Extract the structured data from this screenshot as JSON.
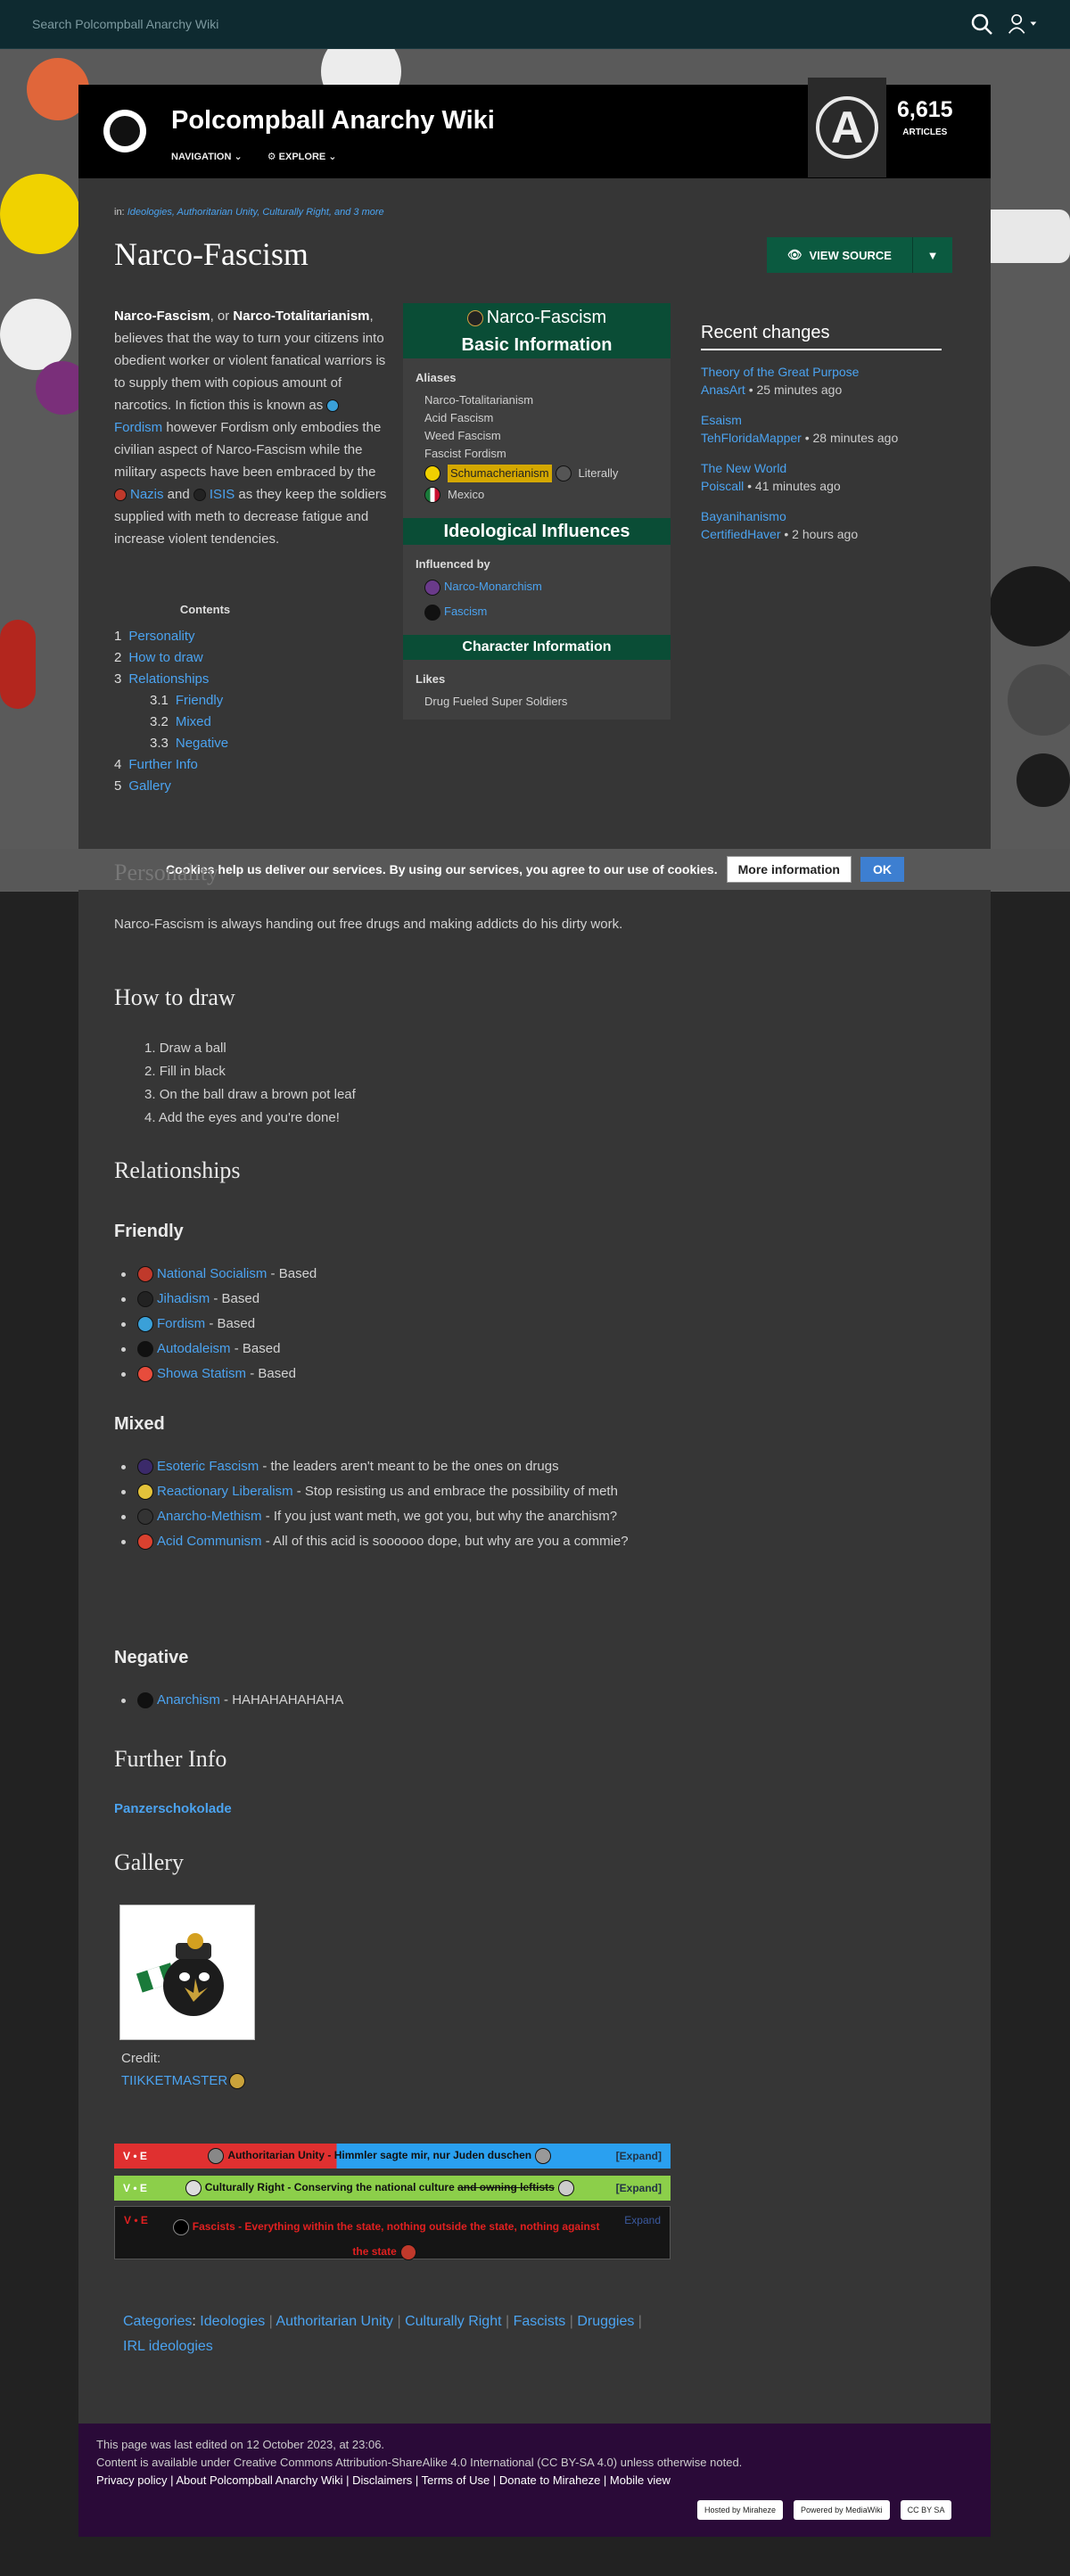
{
  "search": {
    "placeholder": "Search Polcompball Anarchy Wiki"
  },
  "header": {
    "title": "Polcompball Anarchy Wiki",
    "nav1": "NAVIGATION",
    "nav2": "EXPLORE",
    "count": "6,615",
    "count_label": "ARTICLES"
  },
  "page": {
    "categories_prefix": "in:",
    "categories": "Ideologies, Authoritarian Unity, Culturally Right, and 3 more",
    "title": "Narco-Fascism",
    "view_source": "VIEW SOURCE",
    "intro": [
      {
        "t": "Narco-Fascism",
        "b": true
      },
      {
        "t": ", or "
      },
      {
        "t": "Narco-Totalitarianism",
        "b": true
      },
      {
        "t": ", believes that the way to turn your citizens into obedient worker or violent fanatical warriors is to supply them with copious amount of narcotics. In fiction this is known as "
      },
      {
        "t": "Fordism",
        "a": true
      },
      {
        "t": " however Fordism only embodies the civilian aspect of Narco-Fascism while the military aspects have been embraced by the "
      },
      {
        "t": "Nazis",
        "a": true
      },
      {
        "t": " and "
      },
      {
        "t": "ISIS",
        "a": true
      },
      {
        "t": " as they keep the soldiers supplied with meth to decrease fatigue and increase violent tendencies."
      }
    ]
  },
  "toc": {
    "title": "Contents",
    "items": [
      {
        "n": "1",
        "t": "Personality",
        "sub": false
      },
      {
        "n": "2",
        "t": "How to draw",
        "sub": false
      },
      {
        "n": "3",
        "t": "Relationships",
        "sub": false
      },
      {
        "n": "3.1",
        "t": "Friendly",
        "sub": true
      },
      {
        "n": "3.2",
        "t": "Mixed",
        "sub": true
      },
      {
        "n": "3.3",
        "t": "Negative",
        "sub": true
      },
      {
        "n": "4",
        "t": "Further Info",
        "sub": false
      },
      {
        "n": "5",
        "t": "Gallery",
        "sub": false
      }
    ]
  },
  "infobox": {
    "title": "Narco-Fascism",
    "basic": "Basic Information",
    "aliases_label": "Aliases",
    "aliases": [
      "Narco-Totalitarianism",
      "Acid Fascism",
      "Weed Fascism",
      "Fascist Fordism"
    ],
    "alias_schumacher": "Schumacherianism",
    "alias_literally": "Literally",
    "alias_mexico": "Mexico",
    "influences_head": "Ideological Influences",
    "influenced_by_label": "Influenced by",
    "influenced_by": [
      "Narco-Monarchism",
      "Fascism"
    ],
    "character_head": "Character Information",
    "likes_label": "Likes",
    "likes": "Drug Fueled Super Soldiers"
  },
  "recent": {
    "title": "Recent changes",
    "items": [
      {
        "page": "Theory of the Great Purpose",
        "user": "AnasArt",
        "time": " • 25 minutes ago"
      },
      {
        "page": "Esaism",
        "user": "TehFloridaMapper",
        "time": " • 28 minutes ago"
      },
      {
        "page": "The New World",
        "user": "Poiscall",
        "time": " • 41 minutes ago"
      },
      {
        "page": "Bayanihanismo",
        "user": "CertifiedHaver",
        "time": " • 2 hours ago"
      }
    ]
  },
  "cookie": {
    "text": "Cookies help us deliver our services. By using our services, you agree to our use of cookies.",
    "more": "More information",
    "ok": "OK"
  },
  "personality": {
    "heading": "Personality",
    "text": "Narco-Fascism is always handing out free drugs and making addicts do his dirty work."
  },
  "howto": {
    "heading": "How to draw",
    "steps": [
      "Draw a ball",
      "Fill in black",
      "On the ball draw a brown pot leaf",
      "Add the eyes and you're done!"
    ]
  },
  "relationships": {
    "heading": "Relationships",
    "friendly": {
      "heading": "Friendly",
      "items": [
        {
          "name": "National Socialism",
          "note": " - Based",
          "color": "#c0392b"
        },
        {
          "name": "Jihadism",
          "note": " - Based",
          "color": "#222"
        },
        {
          "name": "Fordism",
          "note": " - Based",
          "color": "#3aa0d8"
        },
        {
          "name": "Autodaleism",
          "note": " - Based",
          "color": "#111"
        },
        {
          "name": "Showa Statism",
          "note": " - Based",
          "color": "#e74c3c"
        }
      ]
    },
    "mixed": {
      "heading": "Mixed",
      "items": [
        {
          "name": "Esoteric Fascism",
          "note": " - the leaders aren't meant to be the ones on drugs",
          "color": "#3b2a6a"
        },
        {
          "name": "Reactionary Liberalism",
          "note": " - Stop resisting us and embrace the possibility of meth",
          "color": "#e3c23a"
        },
        {
          "name": "Anarcho-Methism",
          "note": " - If you just want meth, we got you, but why the anarchism?",
          "color": "#333"
        },
        {
          "name": "Acid Communism",
          "note": " - All of this acid is soooooo dope, but why are you a commie?",
          "color": "#d9412f"
        }
      ]
    },
    "negative": {
      "heading": "Negative",
      "items": [
        {
          "name": "Anarchism",
          "note": " - HAHAHAHAHAHA",
          "color": "#111"
        }
      ]
    }
  },
  "further": {
    "heading": "Further Info",
    "link": "Panzerschokolade"
  },
  "gallery": {
    "heading": "Gallery",
    "credit_label": "Credit:",
    "credit_user": "TIIKKETMASTER"
  },
  "navboxes": [
    {
      "vte": "V • E",
      "title": "Authoritarian Unity - Himmler sagte mir, nur Juden duschen",
      "expand": "[Expand]"
    },
    {
      "vte": "V • E",
      "title": "Culturally Right - Conserving the national culture",
      "strike": "and owning leftists",
      "expand": "[Expand]"
    },
    {
      "vte": "V • E",
      "title": "Fascists - Everything within the state, nothing outside the state, nothing against the state",
      "expand": "Expand"
    }
  ],
  "catlinks": {
    "label": "Categories",
    "items": [
      "Ideologies",
      "Authoritarian Unity",
      "Culturally Right",
      "Fascists",
      "Druggies",
      "IRL ideologies"
    ]
  },
  "footer": {
    "edited": "This page was last edited on 12 October 2023, at 23:06.",
    "license": "Content is available under Creative Commons Attribution-ShareAlike 4.0 International (CC BY-SA 4.0) unless otherwise noted.",
    "links": [
      "Privacy policy",
      "About Polcompball Anarchy Wiki",
      "Disclaimers",
      "Terms of Use",
      "Donate to Miraheze",
      "Mobile view"
    ],
    "badges": [
      "Hosted by Miraheze",
      "Powered by MediaWiki",
      "CC BY SA"
    ]
  }
}
